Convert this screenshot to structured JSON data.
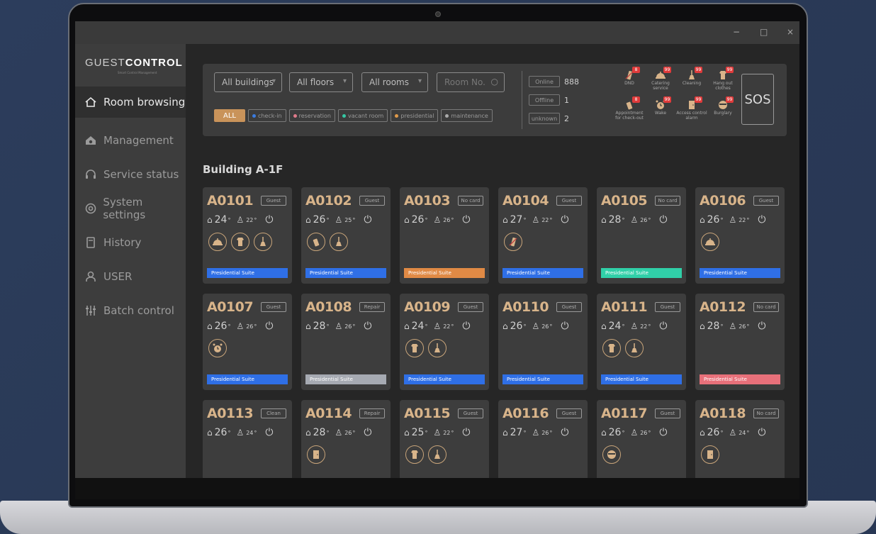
{
  "app": {
    "logo_light": "GUEST",
    "logo_bold": "CONTROL",
    "logo_sub": "Smart Control Management"
  },
  "window": {
    "minimize": "−",
    "maximize": "□",
    "close": "×"
  },
  "sidebar": {
    "items": [
      {
        "label": "Room browsing",
        "icon": "home-icon",
        "active": true
      },
      {
        "label": "Management",
        "icon": "house-gear-icon",
        "active": false
      },
      {
        "label": "Service status",
        "icon": "headset-icon",
        "active": false
      },
      {
        "label": "System settings",
        "icon": "gear-icon",
        "active": false
      },
      {
        "label": "History",
        "icon": "document-icon",
        "active": false
      },
      {
        "label": "USER",
        "icon": "user-icon",
        "active": false
      },
      {
        "label": "Batch control",
        "icon": "sliders-icon",
        "active": false
      }
    ]
  },
  "filters": {
    "buildings": "All buildings",
    "floors": "All floors",
    "rooms": "All rooms",
    "room_no_placeholder": "Room No.",
    "chips": [
      {
        "label": "ALL",
        "color": "#c9935a"
      },
      {
        "label": "check-in",
        "color": "#3a7be0"
      },
      {
        "label": "reservation",
        "color": "#e07a8a"
      },
      {
        "label": "vacant room",
        "color": "#34c8a4"
      },
      {
        "label": "presidential",
        "color": "#e09a4a"
      },
      {
        "label": "maintenance",
        "color": "#aaaaaa"
      }
    ]
  },
  "stats": [
    {
      "label": "Online",
      "value": "888"
    },
    {
      "label": "Offline",
      "value": "1"
    },
    {
      "label": "unknown",
      "value": "2"
    }
  ],
  "alerts": [
    {
      "label": "DND",
      "badge": "8",
      "icon": "dnd-icon"
    },
    {
      "label": "Catering service",
      "badge": "99",
      "icon": "cloche-icon"
    },
    {
      "label": "Cleaning",
      "badge": "99",
      "icon": "broom-icon"
    },
    {
      "label": "Hang out clothes",
      "badge": "99",
      "icon": "shirt-icon"
    },
    {
      "label": "Appointment for check-out",
      "badge": "8",
      "icon": "luggage-icon"
    },
    {
      "label": "Wake",
      "badge": "99",
      "icon": "alarm-icon"
    },
    {
      "label": "Access control alarm",
      "badge": "99",
      "icon": "door-icon"
    },
    {
      "label": "Burglary",
      "badge": "99",
      "icon": "thief-icon"
    }
  ],
  "sos_label": "SOS",
  "building_title": "Building A-1F",
  "rooms": [
    {
      "id": "A0101",
      "status": "Guest",
      "temp": "24",
      "set": "22",
      "icons": [
        "cloche-icon",
        "shirt-icon",
        "broom-icon"
      ],
      "type": "Presidential Suite",
      "color": "#2f6fe6"
    },
    {
      "id": "A0102",
      "status": "Guest",
      "temp": "26",
      "set": "25",
      "icons": [
        "luggage-icon",
        "broom-icon"
      ],
      "type": "Presidential Suite",
      "color": "#2f6fe6"
    },
    {
      "id": "A0103",
      "status": "No card",
      "temp": "26",
      "set": "26",
      "icons": [],
      "type": "Presidential Suite",
      "color": "#e08a45"
    },
    {
      "id": "A0104",
      "status": "Guest",
      "temp": "27",
      "set": "22",
      "icons": [
        "dnd-icon"
      ],
      "type": "Presidential Suite",
      "color": "#2f6fe6"
    },
    {
      "id": "A0105",
      "status": "No card",
      "temp": "28",
      "set": "26",
      "icons": [],
      "type": "Presidential Suite",
      "color": "#30d0a8"
    },
    {
      "id": "A0106",
      "status": "Guest",
      "temp": "26",
      "set": "22",
      "icons": [
        "cloche-icon"
      ],
      "type": "Presidential Suite",
      "color": "#2f6fe6"
    },
    {
      "id": "A0107",
      "status": "Guest",
      "temp": "26",
      "set": "26",
      "icons": [
        "alarm-icon"
      ],
      "type": "Presidential Suite",
      "color": "#2f6fe6"
    },
    {
      "id": "A0108",
      "status": "Repair",
      "temp": "28",
      "set": "26",
      "icons": [],
      "type": "Presidential Suite",
      "color": "#a6aab2"
    },
    {
      "id": "A0109",
      "status": "Guest",
      "temp": "24",
      "set": "22",
      "icons": [
        "shirt-icon",
        "broom-icon"
      ],
      "type": "Presidential Suite",
      "color": "#2f6fe6"
    },
    {
      "id": "A0110",
      "status": "Guest",
      "temp": "26",
      "set": "26",
      "icons": [],
      "type": "Presidential Suite",
      "color": "#2f6fe6"
    },
    {
      "id": "A0111",
      "status": "Guest",
      "temp": "24",
      "set": "22",
      "icons": [
        "shirt-icon",
        "broom-icon"
      ],
      "type": "Presidential Suite",
      "color": "#2f6fe6"
    },
    {
      "id": "A0112",
      "status": "No card",
      "temp": "28",
      "set": "26",
      "icons": [],
      "type": "Presidential Suite",
      "color": "#e8707a"
    },
    {
      "id": "A0113",
      "status": "Clean",
      "temp": "26",
      "set": "24",
      "icons": [],
      "type": "",
      "color": ""
    },
    {
      "id": "A0114",
      "status": "Repair",
      "temp": "28",
      "set": "26",
      "icons": [
        "door-icon"
      ],
      "type": "",
      "color": ""
    },
    {
      "id": "A0115",
      "status": "Guest",
      "temp": "25",
      "set": "22",
      "icons": [
        "shirt-icon",
        "broom-icon"
      ],
      "type": "",
      "color": ""
    },
    {
      "id": "A0116",
      "status": "Guest",
      "temp": "27",
      "set": "26",
      "icons": [],
      "type": "",
      "color": ""
    },
    {
      "id": "A0117",
      "status": "Guest",
      "temp": "26",
      "set": "26",
      "icons": [
        "thief-icon"
      ],
      "type": "",
      "color": ""
    },
    {
      "id": "A0118",
      "status": "No card",
      "temp": "26",
      "set": "24",
      "icons": [
        "door-icon"
      ],
      "type": "",
      "color": ""
    }
  ]
}
